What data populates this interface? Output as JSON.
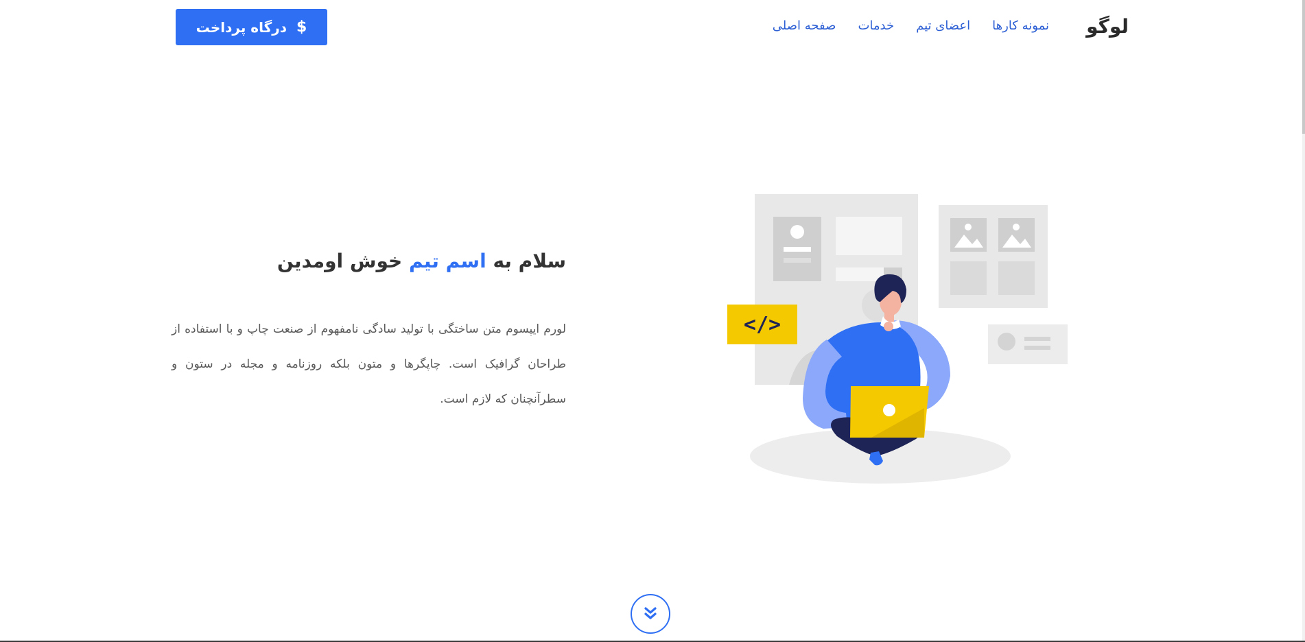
{
  "header": {
    "logo": "لوگو",
    "nav": [
      {
        "label": "صفحه اصلی"
      },
      {
        "label": "خدمات"
      },
      {
        "label": "اعضای تیم"
      },
      {
        "label": "نمونه کارها"
      }
    ],
    "pay_button": {
      "label": "درگاه پرداخت",
      "icon": "dollar-icon",
      "icon_glyph": "$"
    }
  },
  "hero": {
    "title_start": "سلام به",
    "title_accent": "اسم تیم",
    "title_end": "خوش اومدین",
    "paragraph": "لورم ایپسوم متن ساختگی با تولید سادگی نامفهوم از صنعت چاپ و با استفاده از طراحان گرافیک است. چاپگرها و متون بلکه روزنامه و مجله در ستون و سطرآنچنان که لازم است.",
    "illustration_code_tag": "</>"
  },
  "scroll_down": {
    "icon": "chevron-double-down-icon"
  },
  "colors": {
    "accent": "#2f6ff3",
    "nav_link": "#2d5fd4",
    "title": "#333333",
    "body_text": "#5a5a5a",
    "illustration_yellow": "#f5c900",
    "illustration_navy": "#1f2456"
  }
}
